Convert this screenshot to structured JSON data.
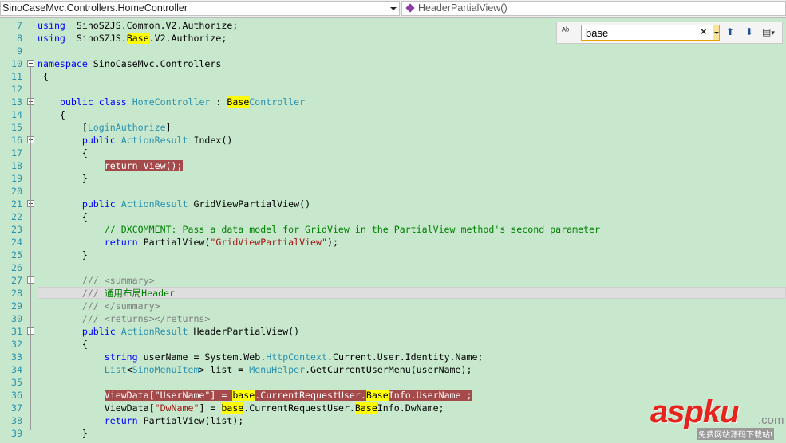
{
  "nav": {
    "type_combo": "SinoCaseMvc.Controllers.HomeController",
    "member_combo": "HeaderPartialView()"
  },
  "find": {
    "value": "base",
    "clear_label": "×",
    "find_prev_label": "⬆",
    "find_next_label": "⬇",
    "options_label": "▾"
  },
  "lines": [
    {
      "n": "7",
      "segs": [
        [
          "kw",
          "using"
        ],
        [
          "",
          "  SinoSZJS.Common.V2.Authorize;"
        ]
      ]
    },
    {
      "n": "8",
      "segs": [
        [
          "kw",
          "using"
        ],
        [
          "",
          "  SinoSZJS."
        ],
        [
          "hl",
          "Base"
        ],
        [
          "",
          ".V2.Authorize;"
        ]
      ]
    },
    {
      "n": "9",
      "segs": []
    },
    {
      "n": "10",
      "segs": [
        [
          "kw",
          "namespace"
        ],
        [
          "",
          " SinoCaseMvc.Controllers"
        ]
      ]
    },
    {
      "n": "11",
      "segs": [
        [
          "",
          " {"
        ]
      ]
    },
    {
      "n": "12",
      "segs": []
    },
    {
      "n": "13",
      "segs": [
        [
          "",
          "    "
        ],
        [
          "kw",
          "public"
        ],
        [
          "",
          " "
        ],
        [
          "kw",
          "class"
        ],
        [
          "",
          " "
        ],
        [
          "ty",
          "HomeController"
        ],
        [
          "",
          " : "
        ],
        [
          "hl",
          "Base"
        ],
        [
          "ty",
          "Controller"
        ]
      ]
    },
    {
      "n": "14",
      "segs": [
        [
          "",
          "    {"
        ]
      ]
    },
    {
      "n": "15",
      "segs": [
        [
          "",
          "        ["
        ],
        [
          "ty",
          "LoginAuthorize"
        ],
        [
          "",
          "]"
        ]
      ]
    },
    {
      "n": "16",
      "segs": [
        [
          "",
          "        "
        ],
        [
          "kw",
          "public"
        ],
        [
          "",
          " "
        ],
        [
          "ty",
          "ActionResult"
        ],
        [
          "",
          " Index()"
        ]
      ]
    },
    {
      "n": "17",
      "segs": [
        [
          "",
          "        {"
        ]
      ]
    },
    {
      "n": "18",
      "segs": [
        [
          "",
          "            "
        ],
        [
          "brk",
          "return View();"
        ]
      ]
    },
    {
      "n": "19",
      "segs": [
        [
          "",
          "        }"
        ]
      ]
    },
    {
      "n": "20",
      "segs": []
    },
    {
      "n": "21",
      "segs": [
        [
          "",
          "        "
        ],
        [
          "kw",
          "public"
        ],
        [
          "",
          " "
        ],
        [
          "ty",
          "ActionResult"
        ],
        [
          "",
          " GridViewPartialView()"
        ]
      ]
    },
    {
      "n": "22",
      "segs": [
        [
          "",
          "        {"
        ]
      ]
    },
    {
      "n": "23",
      "segs": [
        [
          "",
          "            "
        ],
        [
          "cm",
          "// DXCOMMENT: Pass a data model for GridView in the PartialView method's second parameter"
        ]
      ]
    },
    {
      "n": "24",
      "segs": [
        [
          "",
          "            "
        ],
        [
          "kw",
          "return"
        ],
        [
          "",
          " PartialView("
        ],
        [
          "str",
          "\"GridViewPartialView\""
        ],
        [
          "",
          ");"
        ]
      ]
    },
    {
      "n": "25",
      "segs": [
        [
          "",
          "        }"
        ]
      ]
    },
    {
      "n": "26",
      "segs": []
    },
    {
      "n": "27",
      "segs": [
        [
          "",
          "        "
        ],
        [
          "doc",
          "/// <summary>"
        ]
      ]
    },
    {
      "n": "28",
      "segs": [
        [
          "",
          "        "
        ],
        [
          "doc",
          "/// "
        ],
        [
          "cm",
          "通用布局Header"
        ]
      ],
      "current": true
    },
    {
      "n": "29",
      "segs": [
        [
          "",
          "        "
        ],
        [
          "doc",
          "/// </summary>"
        ]
      ]
    },
    {
      "n": "30",
      "segs": [
        [
          "",
          "        "
        ],
        [
          "doc",
          "/// <returns></returns>"
        ]
      ]
    },
    {
      "n": "31",
      "segs": [
        [
          "",
          "        "
        ],
        [
          "kw",
          "public"
        ],
        [
          "",
          " "
        ],
        [
          "ty",
          "ActionResult"
        ],
        [
          "",
          " HeaderPartialView()"
        ]
      ]
    },
    {
      "n": "32",
      "segs": [
        [
          "",
          "        {"
        ]
      ]
    },
    {
      "n": "33",
      "segs": [
        [
          "",
          "            "
        ],
        [
          "kw",
          "string"
        ],
        [
          "",
          " userName = System.Web."
        ],
        [
          "ty",
          "HttpContext"
        ],
        [
          "",
          ".Current.User.Identity.Name;"
        ]
      ]
    },
    {
      "n": "34",
      "segs": [
        [
          "",
          "            "
        ],
        [
          "ty",
          "List"
        ],
        [
          "",
          "<"
        ],
        [
          "ty",
          "SinoMenuItem"
        ],
        [
          "",
          "> list = "
        ],
        [
          "ty",
          "MenuHelper"
        ],
        [
          "",
          ".GetCurrentUserMenu(userName);"
        ]
      ]
    },
    {
      "n": "35",
      "segs": []
    },
    {
      "n": "36",
      "segs": [
        [
          "",
          "            "
        ],
        [
          "brk",
          "ViewData[\"UserName\"] = "
        ],
        [
          "brkhl",
          "base"
        ],
        [
          "brk",
          ".CurrentRequestUser."
        ],
        [
          "brkhl",
          "Base"
        ],
        [
          "brk",
          "Info.UserName ;"
        ]
      ]
    },
    {
      "n": "37",
      "segs": [
        [
          "",
          "            ViewData["
        ],
        [
          "str",
          "\"DwName\""
        ],
        [
          "",
          "] = "
        ],
        [
          "hl",
          "base"
        ],
        [
          "",
          ".CurrentRequestUser."
        ],
        [
          "hl",
          "Base"
        ],
        [
          "",
          "Info.DwName;"
        ]
      ]
    },
    {
      "n": "38",
      "segs": [
        [
          "",
          "            "
        ],
        [
          "kw",
          "return"
        ],
        [
          "",
          " PartialView(list);"
        ]
      ]
    },
    {
      "n": "39",
      "segs": [
        [
          "",
          "        }"
        ]
      ]
    }
  ],
  "folds": [
    "10",
    "13",
    "16",
    "21",
    "27",
    "31"
  ],
  "watermark": {
    "logo": "aspku",
    "suffix": ".com",
    "subtitle": "免费网站源码下载站!"
  }
}
